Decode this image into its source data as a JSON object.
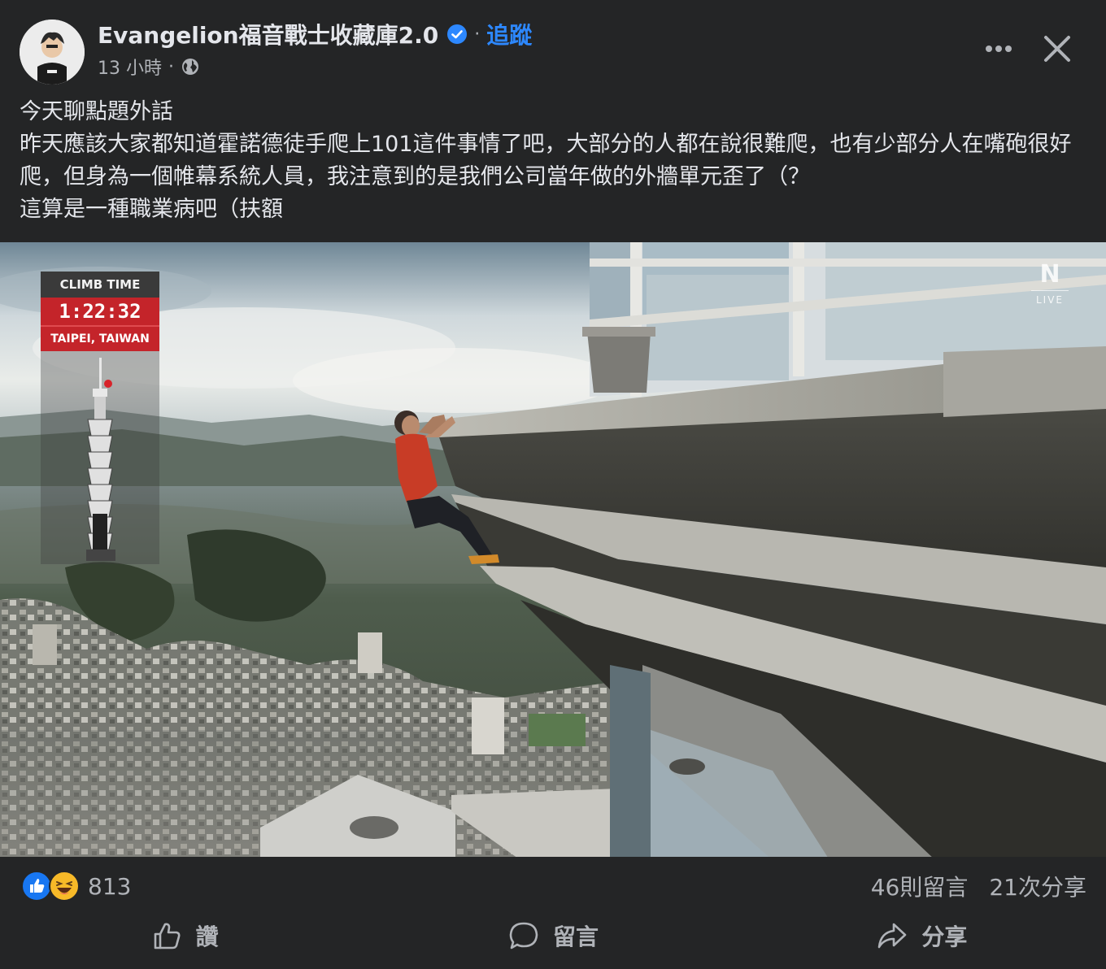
{
  "header": {
    "author": "Evangelion福音戰士收藏庫2.0",
    "separator": "·",
    "follow_label": "追蹤",
    "timestamp": "13 小時",
    "meta_separator": "·",
    "privacy_icon": "globe-icon",
    "more_icon": "more-dots-icon",
    "close_icon": "close-icon"
  },
  "post": {
    "lines": [
      "今天聊點題外話",
      "昨天應該大家都知道霍諾德徒手爬上101這件事情了吧，大部分的人都在說很難爬，也有少部分人在嘴砲很好爬，但身為一個帷幕系統人員，我注意到的是我們公司當年做的外牆單元歪了（？",
      "這算是一種職業病吧（扶額"
    ]
  },
  "photo": {
    "overlay": {
      "title": "CLIMB TIME",
      "time": "1:22:32",
      "location": "TAIPEI, TAIWAN"
    },
    "logo": "N",
    "live_label": "LIVE"
  },
  "engagement": {
    "reaction_icons": [
      "like-icon",
      "haha-icon"
    ],
    "reaction_count": "813",
    "comments": "46則留言",
    "shares": "21次分享"
  },
  "actions": {
    "like_label": "讚",
    "comment_label": "留言",
    "share_label": "分享"
  },
  "colors": {
    "background": "#242526",
    "text": "#e4e6eb",
    "muted": "#b0b3b8",
    "accent": "#2d88ff",
    "overlay_red": "#c4242a"
  }
}
